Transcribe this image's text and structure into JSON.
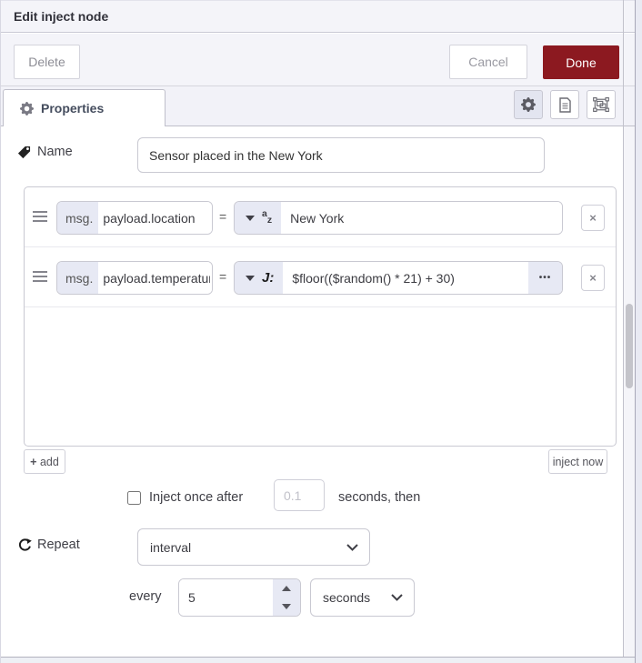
{
  "header": {
    "title": "Edit inject node"
  },
  "toolbar": {
    "delete_label": "Delete",
    "cancel_label": "Cancel",
    "done_label": "Done"
  },
  "tabs": {
    "properties_label": "Properties"
  },
  "colors": {
    "done_red": "#8c1920",
    "chip_lavender": "#e7e9f4"
  },
  "form": {
    "name": {
      "label": "Name",
      "value": "Sensor placed in the New York"
    },
    "rules": [
      {
        "prefix": "msg.",
        "property": "payload.location",
        "operator": "=",
        "type_icon_top": "a",
        "type_icon_bottom": "z",
        "value": "New York"
      },
      {
        "prefix": "msg.",
        "property": "payload.temperature",
        "operator": "=",
        "type_icon": "J:",
        "value": "$floor(($random() * 21) + 30)",
        "expand_icon": "•••"
      }
    ],
    "remove_icon": "×",
    "add_button": {
      "plus": "+",
      "label": "add"
    },
    "inject_now_label": "inject now",
    "once": {
      "label": "Inject once after",
      "value": "0.1",
      "suffix": "seconds, then"
    },
    "repeat": {
      "label": "Repeat",
      "selected": "interval"
    },
    "every": {
      "label": "every",
      "value": "5",
      "unit": "seconds"
    }
  }
}
